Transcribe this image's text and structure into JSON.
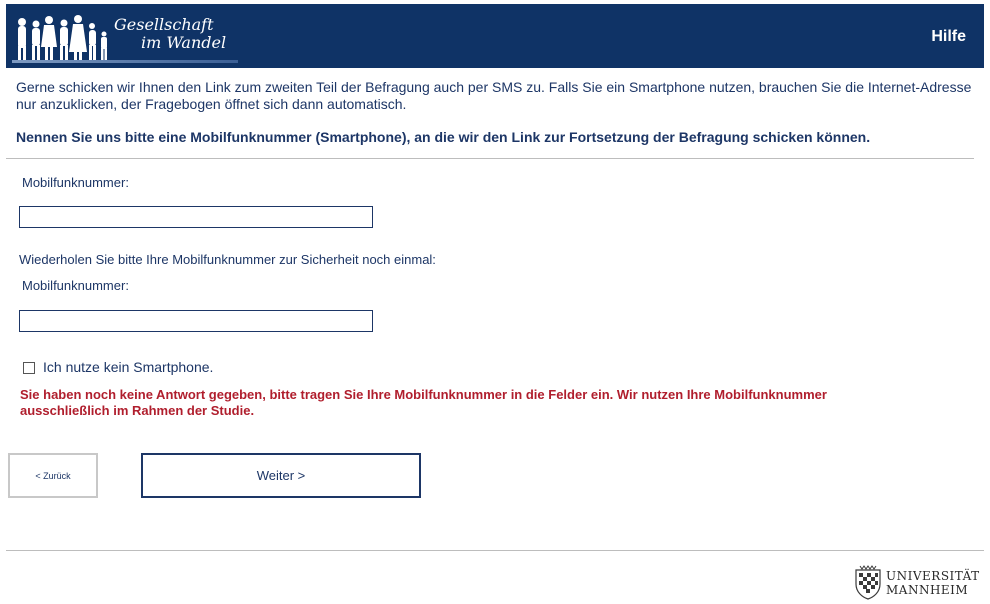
{
  "header": {
    "logo_line1": "Gesellschaft",
    "logo_line2": "im Wandel",
    "help_label": "Hilfe",
    "background_color": "#0f3366"
  },
  "intro_text": "Gerne schicken wir Ihnen den Link zum zweiten Teil der Befragung auch per SMS zu. Falls Sie ein Smartphone nutzen, brauchen Sie die Internet-Adresse nur anzuklicken, der Fragebogen öffnet sich dann automatisch.",
  "question_text": "Nennen Sie uns bitte eine Mobilfunknummer (Smartphone), an die wir den Link zur Fortsetzung der Befragung schicken können.",
  "form": {
    "field1_label": "Mobilfunknummer:",
    "field1_value": "",
    "repeat_instruction": "Wiederholen Sie bitte Ihre Mobilfunknummer zur Sicherheit noch einmal:",
    "field2_label": "Mobilfunknummer:",
    "field2_value": "",
    "checkbox_label": "Ich nutze kein Smartphone.",
    "checkbox_checked": false
  },
  "error_message": "Sie haben noch keine Antwort gegeben, bitte tragen Sie Ihre Mobilfunknummer in die Felder ein. Wir nutzen Ihre Mobilfunknummer ausschließlich im Rahmen der Studie.",
  "navigation": {
    "back_label": "< Zurück",
    "next_label": "Weiter >"
  },
  "footer": {
    "university_line1": "UNIVERSITÄT",
    "university_line2": "MANNHEIM"
  },
  "colors": {
    "text": "#1d3666",
    "error": "#b01e2d",
    "divider": "#bdbdbd"
  }
}
